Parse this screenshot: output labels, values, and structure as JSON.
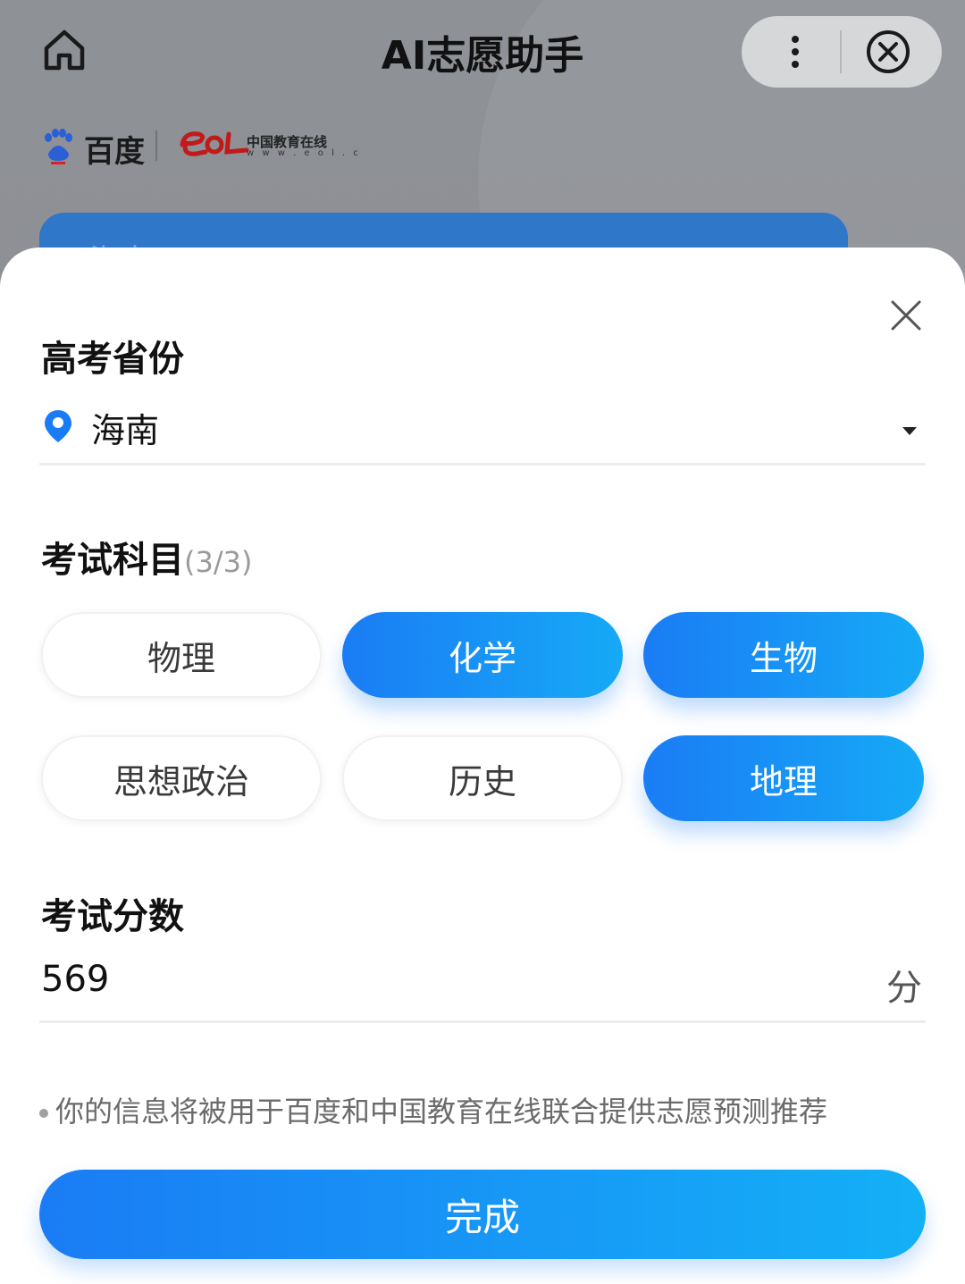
{
  "header": {
    "title": "AI志愿助手"
  },
  "brands": {
    "baidu": "百度",
    "eol_cn": "中国教育在线",
    "eol_url": "w w w . e o l . c"
  },
  "background_card": {
    "text": "海南"
  },
  "form": {
    "province": {
      "label": "高考省份",
      "value": "海南"
    },
    "subjects": {
      "label": "考试科目",
      "count": "(3/3)",
      "options": [
        {
          "label": "物理",
          "selected": false
        },
        {
          "label": "化学",
          "selected": true
        },
        {
          "label": "生物",
          "selected": true
        },
        {
          "label": "思想政治",
          "selected": false
        },
        {
          "label": "历史",
          "selected": false
        },
        {
          "label": "地理",
          "selected": true
        }
      ]
    },
    "score": {
      "label": "考试分数",
      "value": "569",
      "unit": "分"
    },
    "notice": "你的信息将被用于百度和中国教育在线联合提供志愿预测推荐",
    "submit_label": "完成"
  },
  "colors": {
    "accent_start": "#1a7cf5",
    "accent_end": "#16aaf6",
    "location_pin": "#1a7cf5"
  }
}
